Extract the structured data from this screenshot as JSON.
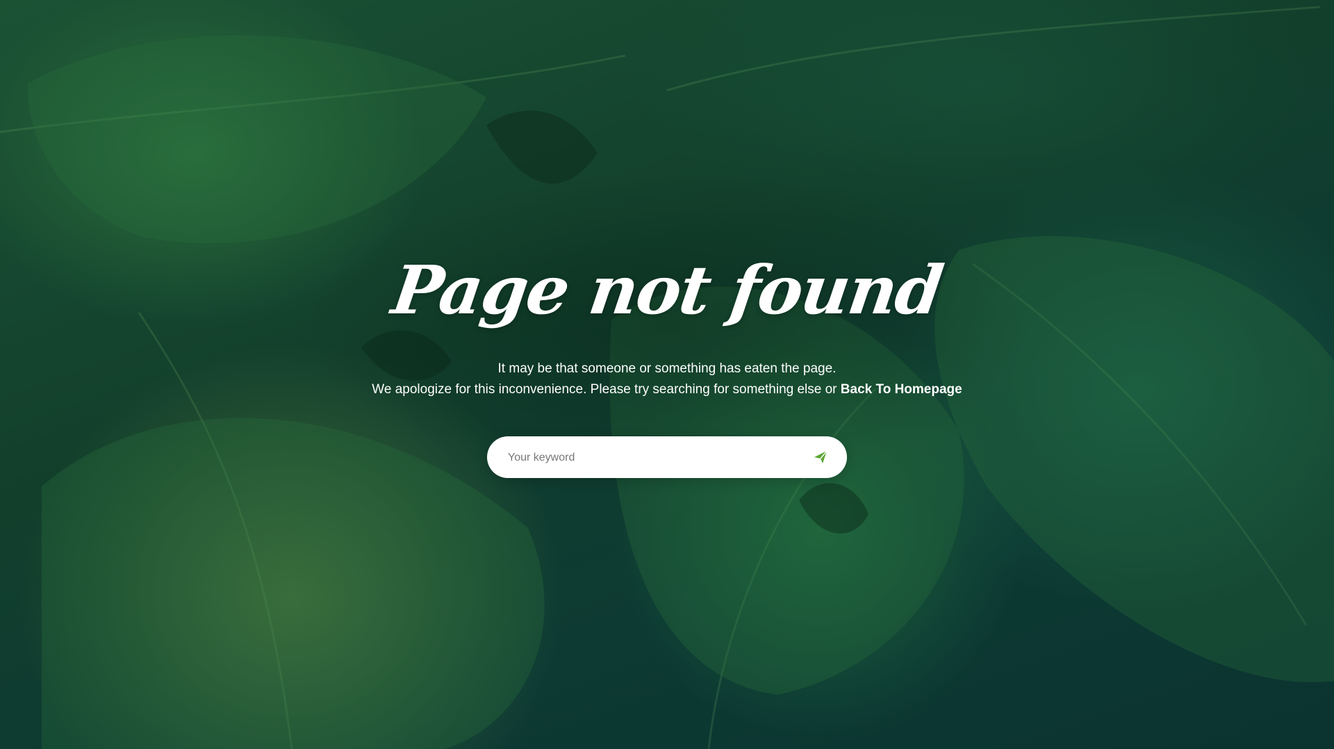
{
  "page": {
    "title": "Page not found",
    "message_line1": "It may be that someone or something has eaten the page.",
    "message_line2_prefix": "We apologize for this inconvenience. Please try searching for something else or ",
    "homepage_link": "Back To Homepage"
  },
  "search": {
    "placeholder": "Your keyword",
    "value": "",
    "submit_icon": "send-icon"
  },
  "colors": {
    "text": "#ffffff",
    "search_bg": "#ffffff",
    "icon_accent": "#5ba531",
    "background": "#123f2c"
  }
}
